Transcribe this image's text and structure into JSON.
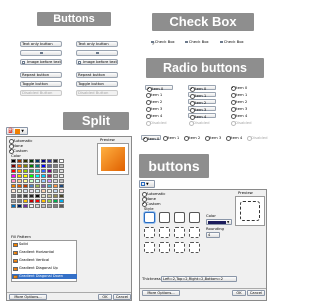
{
  "buttons_panel": {
    "title": "Buttons",
    "left": [
      "Text only button",
      "",
      "Image before text",
      "Repeat button",
      "Toggle button",
      "Disabled Button"
    ],
    "right": [
      "Text only button",
      "",
      "Image before text",
      "Repeat button",
      "Toggle button",
      "Disabled Button"
    ]
  },
  "checkbox_panel": {
    "title": "Check Box",
    "items": [
      "Check Box",
      "Check Box",
      "Check Box"
    ]
  },
  "radio_panel": {
    "title": "Radio buttons",
    "col1": [
      "Item 0",
      "Item 1",
      "Item 2",
      "Item 3",
      "Item 4",
      "Disabled"
    ],
    "col2": [
      "Item 0",
      "Item 1",
      "Item 2",
      "Item 3",
      "Item 4",
      "Disabled"
    ],
    "col3": [
      "Item 0",
      "Item 1",
      "Item 2",
      "Item 3",
      "Item 4",
      "Disabled"
    ],
    "row": [
      "Item 0",
      "Item 1",
      "Item 2",
      "Item 3",
      "Item 4",
      "Disabled"
    ]
  },
  "split_panel": {
    "title": "Split",
    "options": [
      "Automatic",
      "None",
      "Custom"
    ],
    "color_label": "Color",
    "preview_label": "Preview",
    "fill_pattern_label": "Fill Pattern",
    "fills": [
      "Solid",
      "Gradient Horizontal",
      "Gradient Vertical",
      "Gradient Diagonal Up",
      "Gradient Diagonal Down"
    ],
    "more_options": "More Options...",
    "ok": "OK",
    "cancel": "Cancel",
    "accent": "#f08000"
  },
  "buttons_dialog": {
    "title": "buttons",
    "options": [
      "Automatic",
      "None",
      "Custom"
    ],
    "style_label": "Style",
    "color_label": "Color",
    "rounding_label": "Rounding",
    "rounding_value": "4",
    "preview_label": "Preview",
    "thickness_label": "Thickness:",
    "thickness_value": "Left=2,Top=2,Right=2,Bottom=2",
    "more_options": "More Options...",
    "ok": "OK",
    "cancel": "Cancel"
  }
}
